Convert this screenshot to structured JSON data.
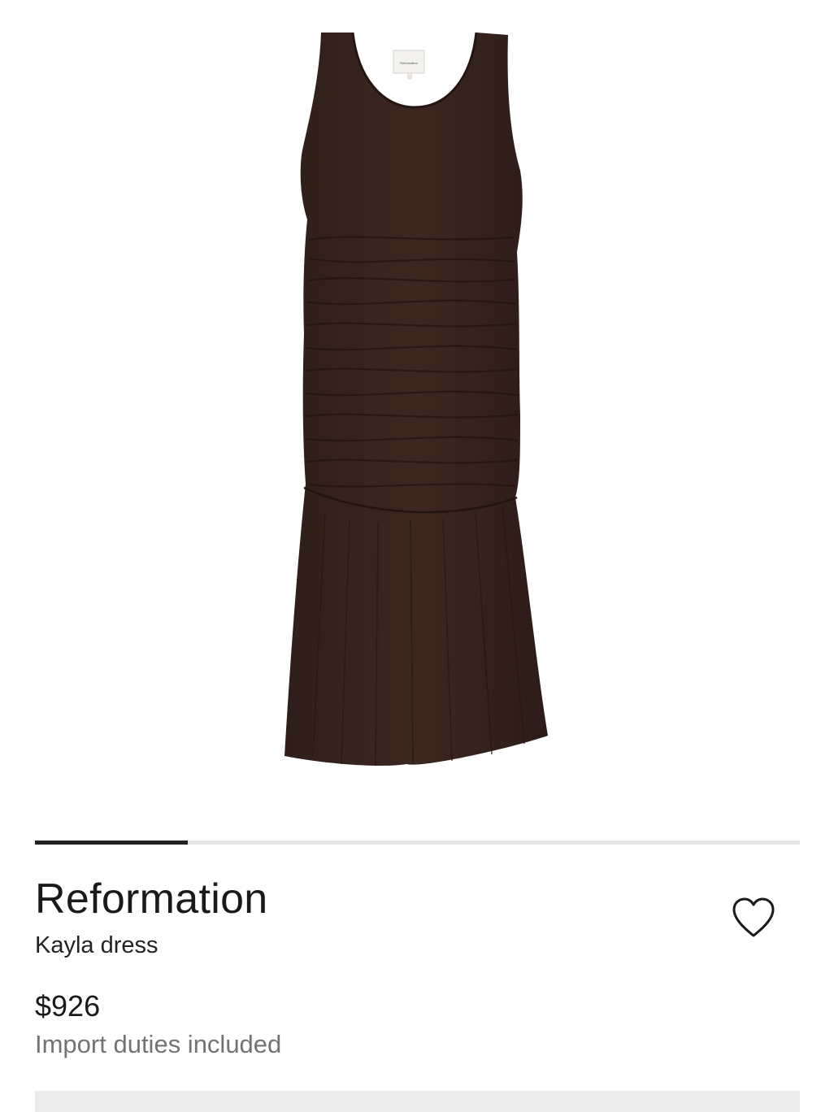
{
  "product": {
    "brand": "Reformation",
    "name": "Kayla dress",
    "price": "$926",
    "duties_note": "Import duties included",
    "image_label": "Reformation",
    "dress_color": "#3a2620"
  },
  "gallery": {
    "progress": 0.2
  },
  "icons": {
    "wishlist": "heart-outline-icon"
  },
  "colors": {
    "text": "#1a1a1a",
    "muted": "#737373",
    "pager_active": "#222222",
    "pager_track": "#e6e6e6"
  }
}
